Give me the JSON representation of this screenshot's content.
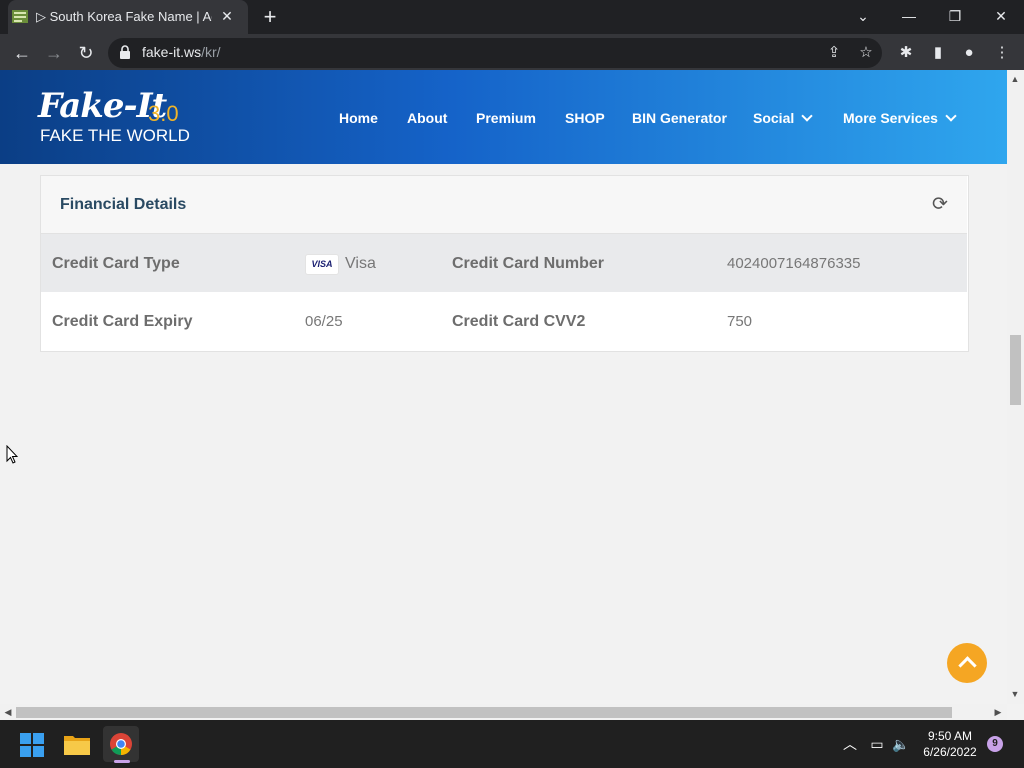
{
  "browser": {
    "tab_title": "▷ South Korea Fake Name | Addr",
    "url_host": "fake-it.ws",
    "url_path": "/kr/"
  },
  "site": {
    "logo_text": "Fake-It",
    "logo_version": "3.0",
    "logo_tagline": "FAKE THE WORLD",
    "nav": [
      "Home",
      "About",
      "Premium",
      "SHOP",
      "BIN Generator",
      "Social",
      "More Services"
    ]
  },
  "financial": {
    "title": "Financial Details",
    "card_type_label": "Credit Card Type",
    "card_type_brand": "VISA",
    "card_type_value": "Visa",
    "card_number_label": "Credit Card Number",
    "card_number_value": "4024007164876335",
    "expiry_label": "Credit Card Expiry",
    "expiry_value": "06/25",
    "cvv_label": "Credit Card CVV2",
    "cvv_value": "750"
  },
  "taskbar": {
    "time": "9:50 AM",
    "date": "6/26/2022",
    "notification_count": "9"
  },
  "colors": {
    "header_start": "#0b3e85",
    "header_end": "#2fa6ee",
    "accent_orange": "#f5a623",
    "card_title": "#2a4a63"
  }
}
